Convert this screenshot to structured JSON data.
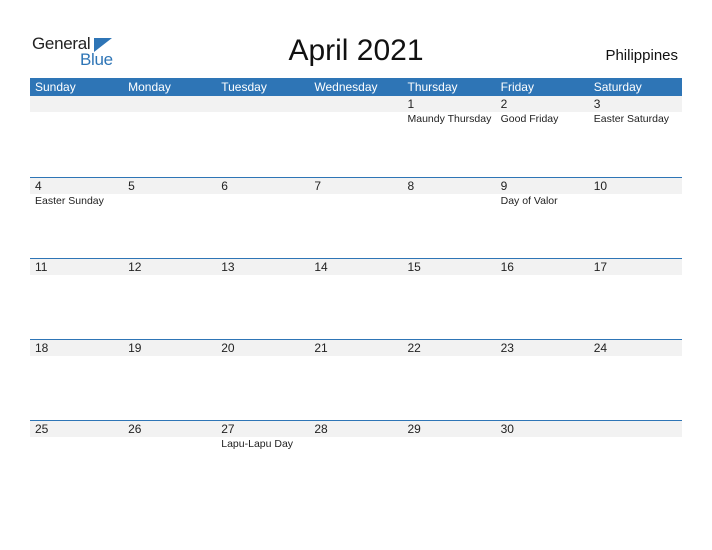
{
  "logo": {
    "general": "General",
    "blue": "Blue"
  },
  "title": "April 2021",
  "country": "Philippines",
  "colors": {
    "accent": "#2e75b6",
    "strip": "#f2f2f2"
  },
  "weekdays": [
    "Sunday",
    "Monday",
    "Tuesday",
    "Wednesday",
    "Thursday",
    "Friday",
    "Saturday"
  ],
  "weeks": [
    {
      "days": [
        "",
        "",
        "",
        "",
        "1",
        "2",
        "3"
      ],
      "events": [
        "",
        "",
        "",
        "",
        "Maundy Thursday",
        "Good Friday",
        "Easter Saturday"
      ]
    },
    {
      "days": [
        "4",
        "5",
        "6",
        "7",
        "8",
        "9",
        "10"
      ],
      "events": [
        "Easter Sunday",
        "",
        "",
        "",
        "",
        "Day of Valor",
        ""
      ]
    },
    {
      "days": [
        "11",
        "12",
        "13",
        "14",
        "15",
        "16",
        "17"
      ],
      "events": [
        "",
        "",
        "",
        "",
        "",
        "",
        ""
      ]
    },
    {
      "days": [
        "18",
        "19",
        "20",
        "21",
        "22",
        "23",
        "24"
      ],
      "events": [
        "",
        "",
        "",
        "",
        "",
        "",
        ""
      ]
    },
    {
      "days": [
        "25",
        "26",
        "27",
        "28",
        "29",
        "30",
        ""
      ],
      "events": [
        "",
        "",
        "Lapu-Lapu Day",
        "",
        "",
        "",
        ""
      ]
    }
  ]
}
